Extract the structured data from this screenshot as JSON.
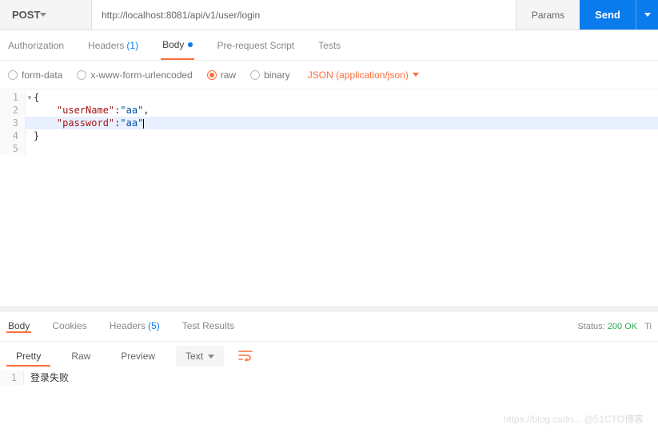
{
  "request": {
    "method": "POST",
    "url": "http://localhost:8081/api/v1/user/login",
    "params_label": "Params",
    "send_label": "Send"
  },
  "tabs": {
    "authorization": "Authorization",
    "headers": "Headers",
    "headers_count": "(1)",
    "body": "Body",
    "prerequest": "Pre-request Script",
    "tests": "Tests"
  },
  "body_types": {
    "formdata": "form-data",
    "urlencoded": "x-www-form-urlencoded",
    "raw": "raw",
    "binary": "binary",
    "content_type": "JSON (application/json)"
  },
  "editor": {
    "lines": [
      "1",
      "2",
      "3",
      "4",
      "5"
    ],
    "l1": "{",
    "l2_key": "\"userName\"",
    "l2_val": "\"aa\"",
    "l3_key": "\"password\"",
    "l3_val": "\"aa\"",
    "l4": "}"
  },
  "response": {
    "tabs": {
      "body": "Body",
      "cookies": "Cookies",
      "headers": "Headers",
      "headers_count": "(5)",
      "tests": "Test Results"
    },
    "status_label": "Status:",
    "status_value": "200 OK",
    "time_label": "Ti",
    "tools": {
      "pretty": "Pretty",
      "raw": "Raw",
      "preview": "Preview",
      "format": "Text"
    },
    "body_line_no": "1",
    "body_text": "登录失败"
  },
  "watermark": "https://blog.csdn... @51CTO博客"
}
